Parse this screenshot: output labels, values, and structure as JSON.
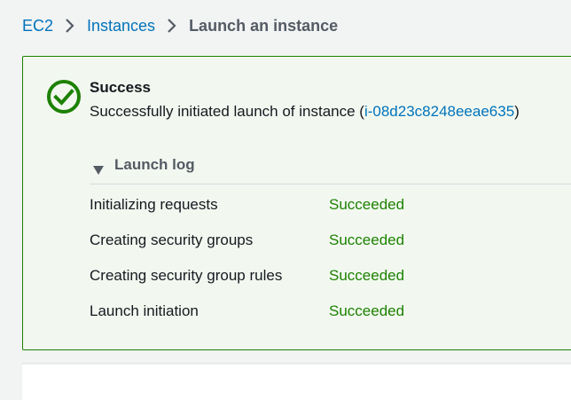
{
  "breadcrumb": {
    "items": [
      {
        "label": "EC2"
      },
      {
        "label": "Instances"
      }
    ],
    "current": "Launch an instance"
  },
  "flash": {
    "type": "success",
    "title": "Success",
    "message_prefix": "Successfully initiated launch of instance (",
    "instance_id": "i-08d23c8248eeae635",
    "message_suffix": ")",
    "log": {
      "label": "Launch log",
      "expanded": true,
      "entries": [
        {
          "step": "Initializing requests",
          "status": "Succeeded"
        },
        {
          "step": "Creating security groups",
          "status": "Succeeded"
        },
        {
          "step": "Creating security group rules",
          "status": "Succeeded"
        },
        {
          "step": "Launch initiation",
          "status": "Succeeded"
        }
      ]
    }
  },
  "icons": {
    "success": "check-circle-icon",
    "separator": "chevron-right-icon",
    "log_toggle": "caret-down-icon"
  },
  "colors": {
    "link": "#0073bb",
    "success": "#1d8102",
    "success_bg": "#f2f8f0",
    "muted": "#545b64"
  }
}
